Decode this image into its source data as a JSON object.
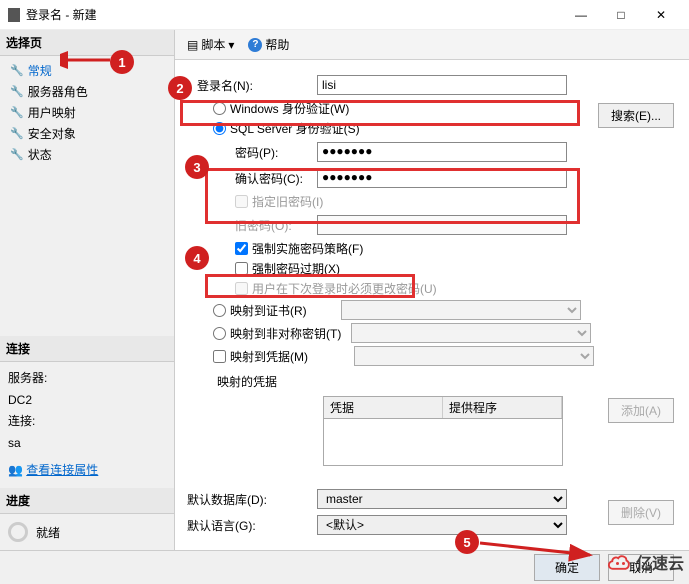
{
  "title": "登录名 - 新建",
  "toolbar": {
    "script": "脚本",
    "help": "帮助"
  },
  "select_page": {
    "header": "选择页",
    "items": [
      "常规",
      "服务器角色",
      "用户映射",
      "安全对象",
      "状态"
    ]
  },
  "connection": {
    "header": "连接",
    "server_label": "服务器:",
    "server_value": "DC2",
    "conn_label": "连接:",
    "conn_value": "sa",
    "view_props": "查看连接属性"
  },
  "progress": {
    "header": "进度",
    "status": "就绪"
  },
  "form": {
    "login_name_label": "登录名(N):",
    "login_name_value": "lisi",
    "search_btn": "搜索(E)...",
    "windows_auth": "Windows 身份验证(W)",
    "sql_auth": "SQL Server 身份验证(S)",
    "password_label": "密码(P):",
    "password_value": "●●●●●●●",
    "confirm_label": "确认密码(C):",
    "confirm_value": "●●●●●●●",
    "old_pwd": "指定旧密码(I)",
    "old_pwd_label": "旧密码(O):",
    "enforce_policy": "强制实施密码策略(F)",
    "enforce_expire": "强制密码过期(X)",
    "must_change": "用户在下次登录时必须更改密码(U)",
    "map_cert": "映射到证书(R)",
    "map_asym": "映射到非对称密钥(T)",
    "map_cred": "映射到凭据(M)",
    "add_btn": "添加(A)",
    "mapped_creds": "映射的凭据",
    "cred_col1": "凭据",
    "cred_col2": "提供程序",
    "del_btn": "删除(V)",
    "default_db_label": "默认数据库(D):",
    "default_db_value": "master",
    "default_lang_label": "默认语言(G):",
    "default_lang_value": "<默认>"
  },
  "footer": {
    "ok": "确定",
    "cancel": "取消"
  },
  "numbers": {
    "n1": "1",
    "n2": "2",
    "n3": "3",
    "n4": "4",
    "n5": "5"
  },
  "watermark": "亿速云"
}
